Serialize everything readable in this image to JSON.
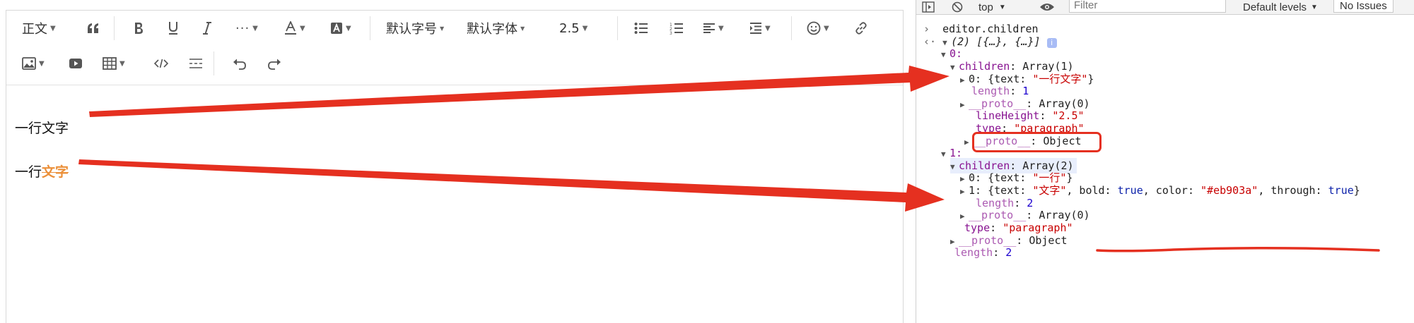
{
  "editor": {
    "toolbar": {
      "heading": "正文",
      "font_size": "默认字号",
      "font_family": "默认字体",
      "line_height": "2.5"
    },
    "paragraphs": [
      {
        "text": "一行文字"
      },
      {
        "plain": "一行",
        "styled": "文字"
      }
    ]
  },
  "devtools": {
    "context": "top",
    "filter_placeholder": "Filter",
    "levels": "Default levels",
    "issues": "No Issues",
    "lines": {
      "l0": "editor.children",
      "l1": "(2) [{…}, {…}]",
      "l2": "0:",
      "l3a": "children",
      "l3b": ": Array(1)",
      "l4a": "0: {text: ",
      "l4b": "\"一行文字\"",
      "l4c": "}",
      "l5a": "length",
      "l5b": ": ",
      "l5c": "1",
      "l6a": "__proto__",
      "l6b": ": Array(0)",
      "l7a": "lineHeight",
      "l7b": ": ",
      "l7c": "\"2.5\"",
      "l8a": "type",
      "l8b": ": ",
      "l8c": "\"paragraph\"",
      "l9a": "__proto__",
      "l9b": ": Object",
      "l10": "1:",
      "l11a": "children",
      "l11b": ": Array(2)",
      "l12a": "0: {text: ",
      "l12b": "\"一行\"",
      "l12c": "}",
      "l13a": "1: {text: ",
      "l13b": "\"文字\"",
      "l13c": ", bold: ",
      "l13d": "true",
      "l13e": ", color: ",
      "l13f": "\"#eb903a\"",
      "l13g": ", through: ",
      "l13h": "true",
      "l13i": "}",
      "l14a": "length",
      "l14b": ": ",
      "l14c": "2",
      "l15a": "__proto__",
      "l15b": ": Array(0)",
      "l16a": "type",
      "l16b": ": ",
      "l16c": "\"paragraph\"",
      "l17a": "__proto__",
      "l17b": ": Object",
      "l18a": "length",
      "l18b": ": ",
      "l18c": "2"
    }
  },
  "colors": {
    "annotation_red": "#e53020",
    "text_orange": "#eb903a"
  }
}
